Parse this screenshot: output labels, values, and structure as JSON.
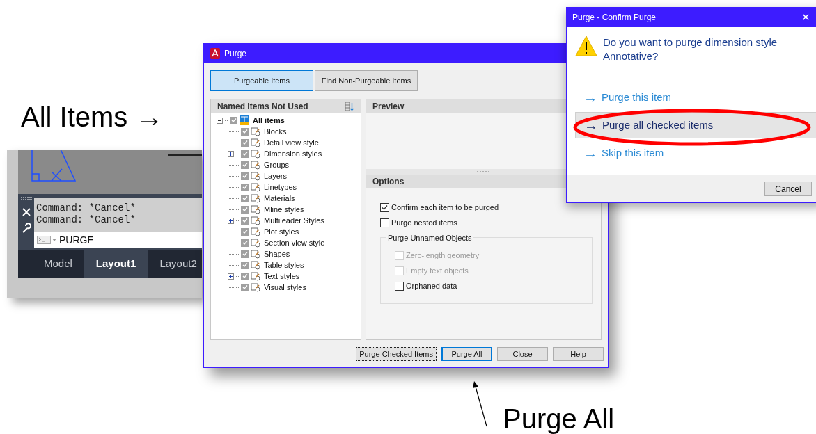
{
  "annotations": {
    "all_items": "All Items →",
    "purge_all": "Purge All"
  },
  "command_window": {
    "history": [
      "Command: *Cancel*",
      "Command: *Cancel*"
    ],
    "input": "PURGE",
    "tabs": [
      {
        "label": "Model",
        "selected": false
      },
      {
        "label": "Layout1",
        "selected": true
      },
      {
        "label": "Layout2",
        "selected": false
      }
    ]
  },
  "purge_dialog": {
    "title": "Purge",
    "tabs": [
      {
        "label": "Purgeable Items",
        "selected": true
      },
      {
        "label": "Find Non-Purgeable Items",
        "selected": false
      }
    ],
    "tree_header": "Named Items Not Used",
    "tree": {
      "label": "All items",
      "checked": true,
      "expanded": true,
      "children": [
        {
          "label": "Blocks",
          "checked": true,
          "expandable": false
        },
        {
          "label": "Detail view style",
          "checked": true,
          "expandable": false
        },
        {
          "label": "Dimension styles",
          "checked": true,
          "expandable": true
        },
        {
          "label": "Groups",
          "checked": true,
          "expandable": false
        },
        {
          "label": "Layers",
          "checked": true,
          "expandable": false
        },
        {
          "label": "Linetypes",
          "checked": true,
          "expandable": false
        },
        {
          "label": "Materials",
          "checked": true,
          "expandable": false
        },
        {
          "label": "Mline styles",
          "checked": true,
          "expandable": false
        },
        {
          "label": "Multileader Styles",
          "checked": true,
          "expandable": true
        },
        {
          "label": "Plot styles",
          "checked": true,
          "expandable": false
        },
        {
          "label": "Section view style",
          "checked": true,
          "expandable": false
        },
        {
          "label": "Shapes",
          "checked": true,
          "expandable": false
        },
        {
          "label": "Table styles",
          "checked": true,
          "expandable": false
        },
        {
          "label": "Text styles",
          "checked": true,
          "expandable": true
        },
        {
          "label": "Visual styles",
          "checked": true,
          "expandable": false
        }
      ]
    },
    "preview_header": "Preview",
    "options_header": "Options",
    "options": [
      {
        "label": "Confirm each item to be purged",
        "checked": true,
        "disabled": false
      },
      {
        "label": "Purge nested items",
        "checked": false,
        "disabled": false
      }
    ],
    "unnamed_group": {
      "title": "Purge Unnamed Objects",
      "options": [
        {
          "label": "Zero-length geometry",
          "checked": false,
          "disabled": true
        },
        {
          "label": "Empty text objects",
          "checked": false,
          "disabled": true
        },
        {
          "label": "Orphaned data",
          "checked": false,
          "disabled": false
        }
      ]
    },
    "buttons": [
      {
        "label": "Purge Checked Items",
        "kind": "focused"
      },
      {
        "label": "Purge All",
        "kind": "default"
      },
      {
        "label": "Close",
        "kind": "normal"
      },
      {
        "label": "Help",
        "kind": "normal"
      }
    ]
  },
  "confirm_dialog": {
    "title": "Purge - Confirm Purge",
    "close": "✕",
    "message": "Do you want to purge dimension style Annotative?",
    "commands": [
      {
        "label": "Purge this item",
        "selected": false,
        "arrow": "→"
      },
      {
        "label": "Purge all checked items",
        "selected": true,
        "arrow": "→"
      },
      {
        "label": "Skip this item",
        "selected": false,
        "arrow": "→"
      }
    ],
    "cancel": "Cancel"
  }
}
